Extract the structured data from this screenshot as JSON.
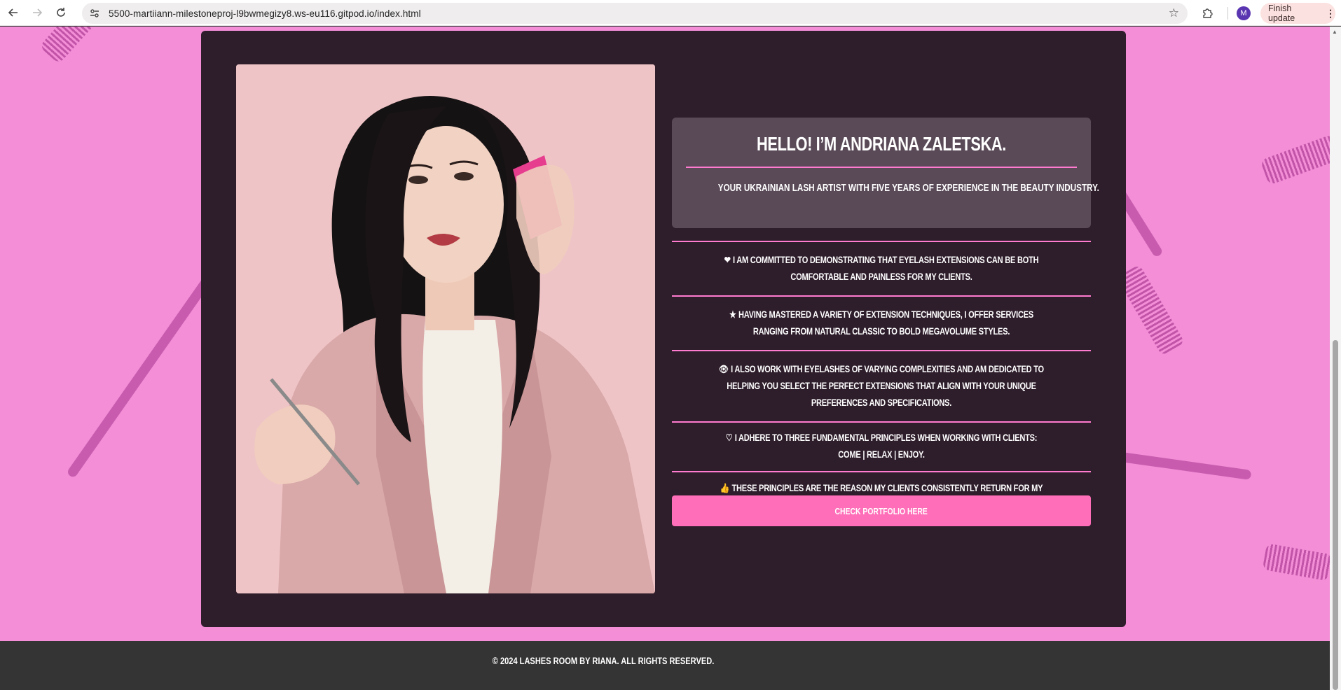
{
  "browser": {
    "url": "5500-martiiann-milestoneproj-l9bwmegizy8.ws-eu116.gitpod.io/index.html",
    "profile_initial": "M",
    "update_label": "Finish update",
    "icons": {
      "back": "arrow-left-icon",
      "forward": "arrow-right-icon",
      "reload": "reload-icon",
      "site_info": "tune-icon",
      "bookmark": "star-icon",
      "extensions": "puzzle-icon",
      "menu": "more-vert-icon"
    }
  },
  "about": {
    "heading": "Hello! I’m Andriana Zaletska.",
    "subheading": "Your Ukrainian lash artist with five years of experience in the beauty industry.",
    "facts": [
      {
        "icon": "heart-icon",
        "text": "I am committed to demonstrating that eyelash extensions can be both comfortable and painless for my clients."
      },
      {
        "icon": "star-icon",
        "text": "Having mastered a variety of extension techniques, I offer services ranging from natural classic to bold megavolume styles."
      },
      {
        "icon": "eye-icon",
        "text": "I also work with eyelashes of varying complexities and am dedicated to helping you select the perfect extensions that align with your unique preferences and specifications."
      },
      {
        "icon": "heart-outline-icon",
        "text": "I adhere to three fundamental principles when working with clients: come | relax | enjoy."
      },
      {
        "icon": "thumbs-up-icon",
        "text": "These principles are the reason my clients consistently return for my services."
      }
    ],
    "portfolio_button": "Check portfolio here"
  },
  "footer": {
    "copyright": "© 2024 Lashes Room by Riana. All rights reserved."
  },
  "colors": {
    "page_bg": "#f38ed7",
    "card_bg": "#2e1d2b",
    "accent": "#ff7bd0",
    "button": "#ff6eb8",
    "footer_bg": "#343434"
  }
}
